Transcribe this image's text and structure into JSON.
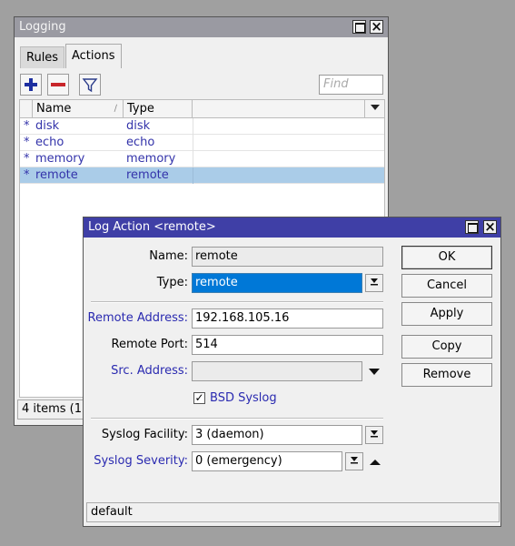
{
  "logging": {
    "title": "Logging",
    "tabs": [
      "Rules",
      "Actions"
    ],
    "find_placeholder": "Find",
    "columns": [
      "Name",
      "Type"
    ],
    "rows": [
      {
        "marker": "*",
        "name": "disk",
        "type": "disk",
        "selected": false
      },
      {
        "marker": "*",
        "name": "echo",
        "type": "echo",
        "selected": false
      },
      {
        "marker": "*",
        "name": "memory",
        "type": "memory",
        "selected": false
      },
      {
        "marker": "*",
        "name": "remote",
        "type": "remote",
        "selected": true
      }
    ],
    "status": "4 items (1 s"
  },
  "dialog": {
    "title": "Log Action <remote>",
    "name_label": "Name:",
    "name_value": "remote",
    "type_label": "Type:",
    "type_value": "remote",
    "remote_address_label": "Remote Address:",
    "remote_address_value": "192.168.105.16",
    "remote_port_label": "Remote Port:",
    "remote_port_value": "514",
    "src_address_label": "Src. Address:",
    "src_address_value": "",
    "bsd_syslog_label": "BSD Syslog",
    "bsd_syslog_checked": true,
    "syslog_facility_label": "Syslog Facility:",
    "syslog_facility_value": "3 (daemon)",
    "syslog_severity_label": "Syslog Severity:",
    "syslog_severity_value": "0 (emergency)",
    "buttons": {
      "ok": "OK",
      "cancel": "Cancel",
      "apply": "Apply",
      "copy": "Copy",
      "remove": "Remove"
    },
    "status": "default"
  }
}
